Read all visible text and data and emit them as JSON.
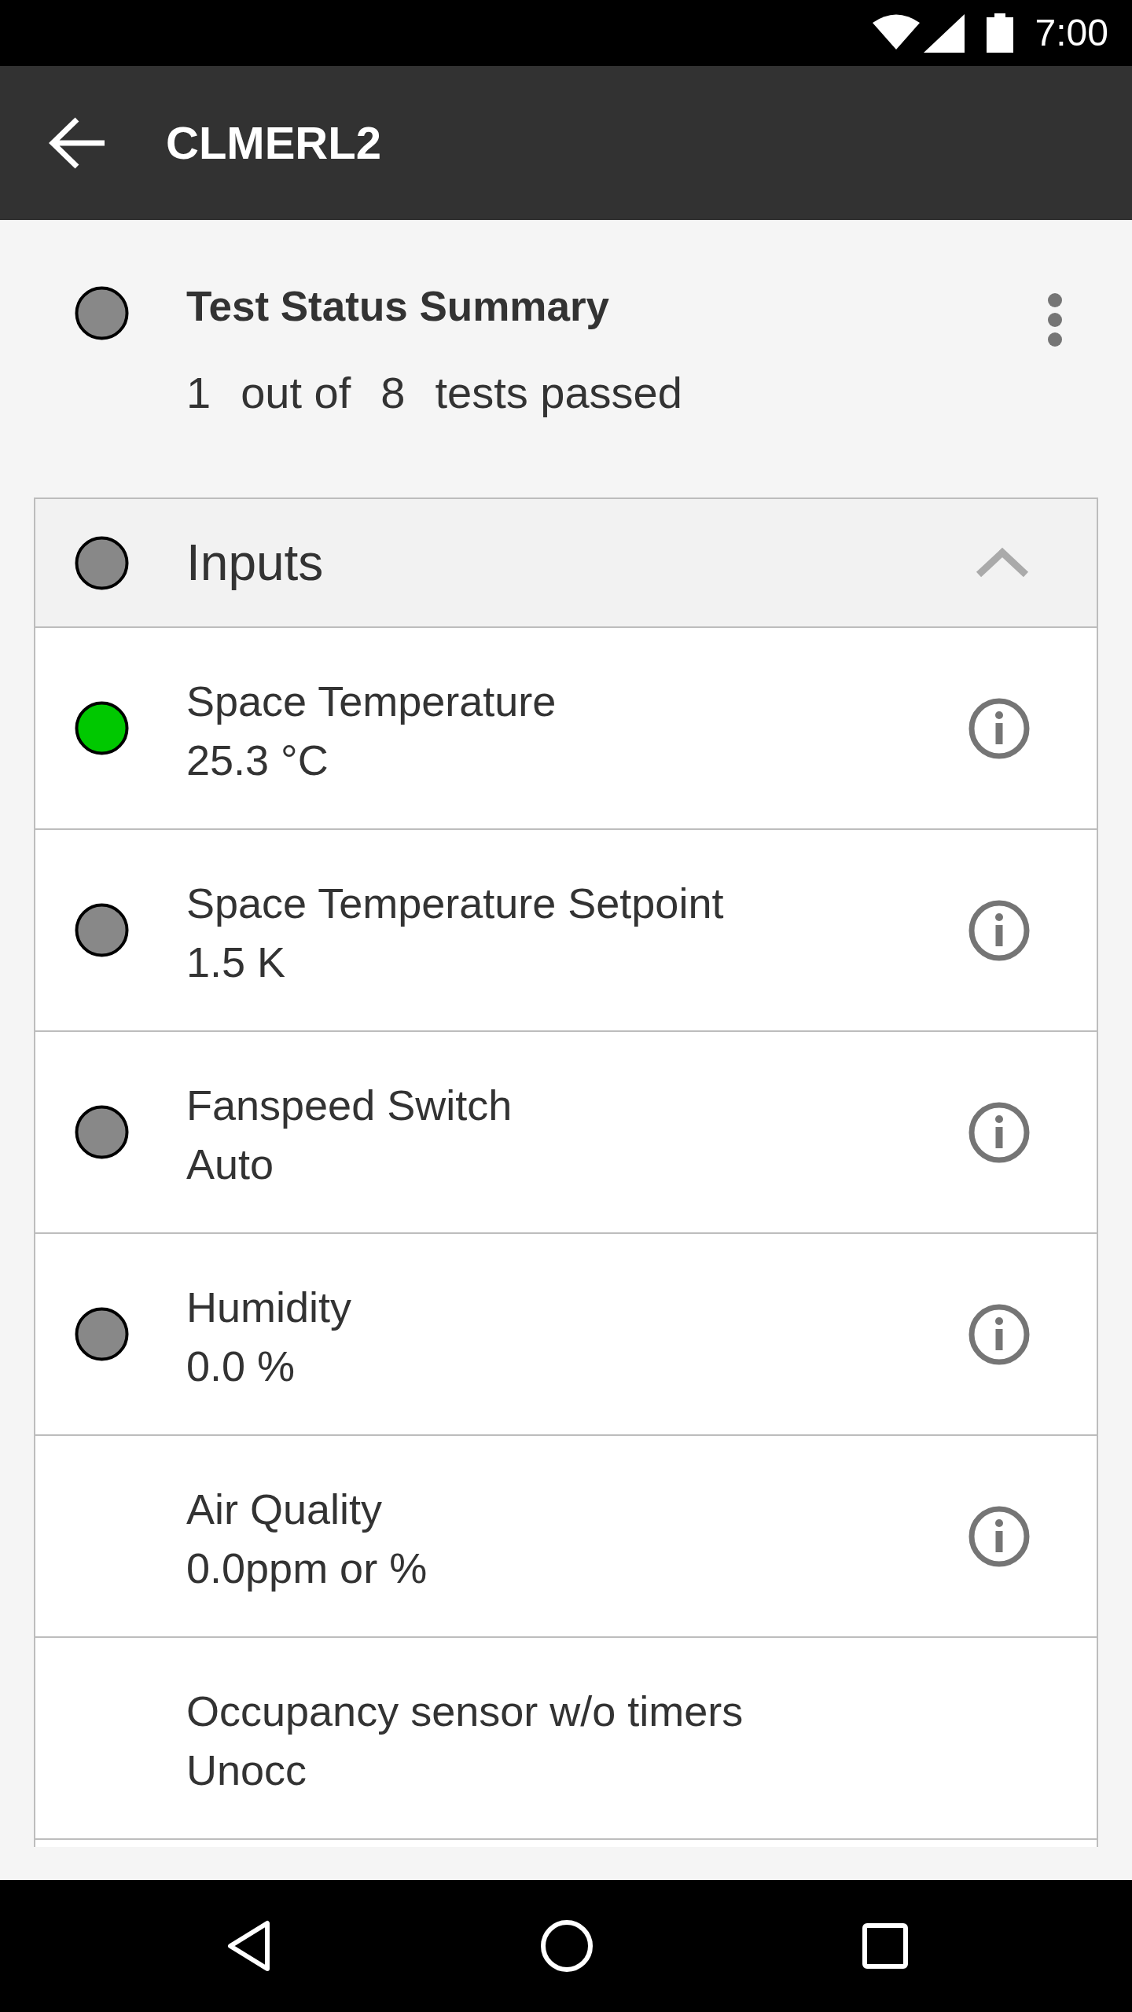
{
  "status_bar": {
    "time": "7:00"
  },
  "app_bar": {
    "title": "CLMERL2"
  },
  "summary": {
    "title": "Test Status Summary",
    "color": "#888888",
    "passed": "1",
    "out_of": "out of",
    "total": "8",
    "suffix": "tests passed"
  },
  "section": {
    "title": "Inputs",
    "color": "#888888",
    "expanded": true,
    "items": [
      {
        "name": "Space Temperature",
        "value": "25.3 °C",
        "color": "#00c800",
        "info": true
      },
      {
        "name": "Space Temperature Setpoint",
        "value": "1.5 K",
        "color": "#888888",
        "info": true
      },
      {
        "name": "Fanspeed Switch",
        "value": "Auto",
        "color": "#888888",
        "info": true
      },
      {
        "name": "Humidity",
        "value": "0.0 %",
        "color": "#888888",
        "info": true
      },
      {
        "name": "Air Quality",
        "value": "0.0ppm or %",
        "info": true
      },
      {
        "name": "Occupancy sensor w/o timers",
        "value": "Unocc",
        "info": false
      }
    ]
  }
}
